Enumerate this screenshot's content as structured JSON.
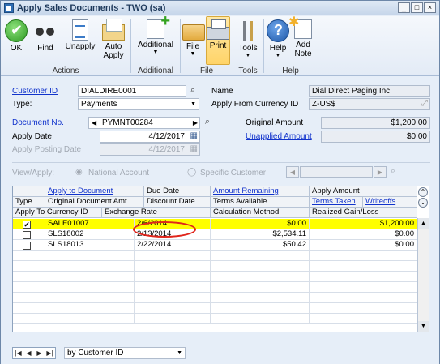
{
  "window": {
    "title": "Apply Sales Documents  -  TWO (sa)",
    "min": "_",
    "max": "□",
    "close": "×"
  },
  "ribbon": {
    "ok": "OK",
    "find": "Find",
    "unapply": "Unapply",
    "auto_apply": "Auto\nApply",
    "additional": "Additional",
    "file": "File",
    "print": "Print",
    "tools": "Tools",
    "help": "Help",
    "add_note": "Add\nNote",
    "groups": {
      "actions": "Actions",
      "additional": "Additional",
      "file": "File",
      "tools": "Tools",
      "help": "Help"
    }
  },
  "form": {
    "customer_id_label": "Customer ID",
    "customer_id": "DIALDIRE0001",
    "name_label": "Name",
    "name": "Dial Direct Paging Inc.",
    "type_label": "Type:",
    "type": "Payments",
    "apply_from_currency_label": "Apply From Currency ID",
    "apply_from_currency": "Z-US$",
    "document_no_label": "Document No.",
    "document_no": "PYMNT00284",
    "original_amount_label": "Original Amount",
    "original_amount": "$1,200.00",
    "apply_date_label": "Apply Date",
    "apply_date": "4/12/2017",
    "unapplied_amount_label": "Unapplied Amount",
    "unapplied_amount": "$0.00",
    "apply_posting_date_label": "Apply Posting Date",
    "apply_posting_date": "4/12/2017",
    "view_apply_label": "View/Apply:",
    "national_account": "National Account",
    "specific_customer": "Specific Customer"
  },
  "grid": {
    "header1": [
      "",
      "Apply to Document",
      "Due Date",
      "Amount Remaining",
      "Apply Amount"
    ],
    "header2": [
      "Type",
      "Original Document Amt",
      "Discount Date",
      "Terms Available",
      "Terms Taken",
      "Writeoffs"
    ],
    "header3": [
      "Apply To Currency ID",
      "Exchange Rate",
      "",
      "Calculation Method",
      "Realized Gain/Loss"
    ],
    "rows": [
      {
        "checked": "✔",
        "document": "SALE01007",
        "due_date": "2/6/2014",
        "remaining": "$0.00",
        "apply": "$1,200.00"
      },
      {
        "checked": "",
        "document": "SLS18002",
        "due_date": "2/13/2014",
        "remaining": "$2,534.11",
        "apply": "$0.00"
      },
      {
        "checked": "",
        "document": "SLS18013",
        "due_date": "2/22/2014",
        "remaining": "$50.42",
        "apply": "$0.00"
      }
    ]
  },
  "bottom": {
    "sort_by": "by Customer ID"
  },
  "colors": {
    "highlight": "#ffff00",
    "annotation": "#e0251b",
    "link": "#1133cc"
  }
}
